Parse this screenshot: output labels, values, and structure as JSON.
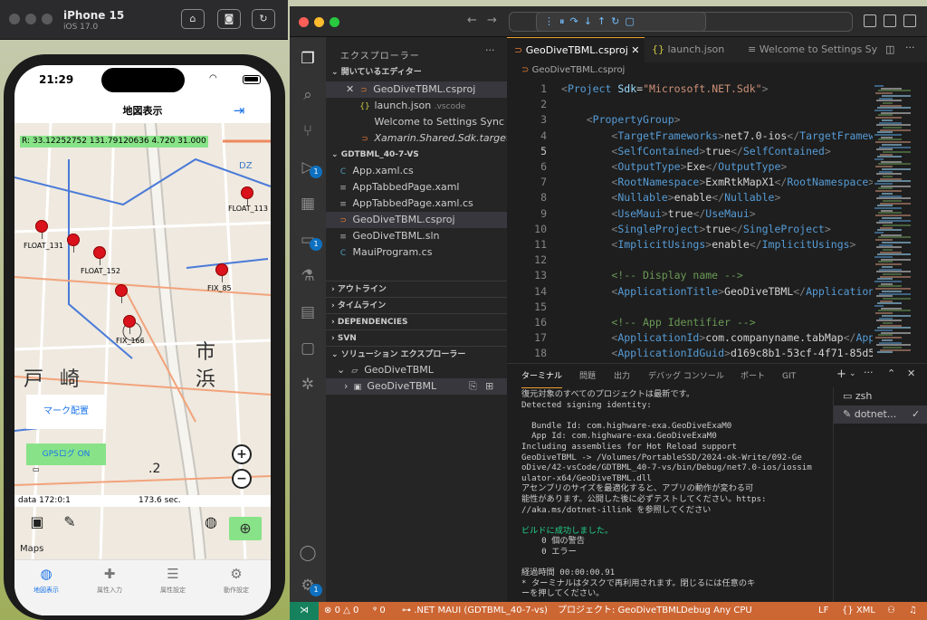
{
  "simulator": {
    "device": "iPhone 15",
    "os": "iOS 17.0",
    "buttons": [
      "home-icon",
      "screenshot-icon",
      "rotate-icon"
    ]
  },
  "phone": {
    "time": "21:29",
    "nav_title": "地図表示",
    "coord_readout": "R: 33.12252752 131.79120636 4.720 31.000",
    "dz_label": "DZ",
    "pins": [
      {
        "label": "FLOAT_113"
      },
      {
        "label": "FLOAT_131"
      },
      {
        "label": "FLOAT_152"
      },
      {
        "label": "FIX_85"
      },
      {
        "label": "FIX_166"
      }
    ],
    "mark_button": "マーク配置",
    "gps_button": "GPSログ ON",
    "scale_label": ".2",
    "data_text": "data 172:0:1",
    "sec_text": "173.6 sec.",
    "maps_label": "Maps",
    "tabs": [
      {
        "label": "地図表示",
        "icon": "globe-icon"
      },
      {
        "label": "属性入力",
        "icon": "pin-icon"
      },
      {
        "label": "属性設定",
        "icon": "list-icon"
      },
      {
        "label": "動作設定",
        "icon": "gear-icon"
      }
    ]
  },
  "vscode": {
    "sidebar_title": "エクスプローラー",
    "open_editors_header": "開いているエディター",
    "open_editors": [
      {
        "name": "GeoDiveTBML.csproj",
        "suffix": ""
      },
      {
        "name": "launch.json",
        "suffix": ".vscode"
      },
      {
        "name": "Welcome to Settings Sync",
        "suffix": ""
      },
      {
        "name": "Xamarin.Shared.Sdk.targets...",
        "suffix": ""
      }
    ],
    "folder_header": "GDTBML_40-7-VS",
    "files": [
      "App.xaml.cs",
      "AppTabbedPage.xaml",
      "AppTabbedPage.xaml.cs",
      "GeoDiveTBML.csproj",
      "GeoDiveTBML.sln",
      "MauiProgram.cs"
    ],
    "sections": [
      "アウトライン",
      "タイムライン",
      "DEPENDENCIES",
      "SVN",
      "ソリューション エクスプローラー"
    ],
    "solution": "GeoDiveTBML",
    "solution_project": "GeoDiveTBML",
    "editor_tabs": [
      "GeoDiveTBML.csproj",
      "launch.json",
      "Welcome to Settings Sync"
    ],
    "breadcrumb": "GeoDiveTBML.csproj",
    "code_lines": [
      {
        "n": "1",
        "t": "<Project Sdk=\"Microsoft.NET.Sdk\">"
      },
      {
        "n": "2",
        "t": ""
      },
      {
        "n": "3",
        "t": "    <PropertyGroup>"
      },
      {
        "n": "4",
        "t": "        <TargetFrameworks>net7.0-ios</TargetFramew"
      },
      {
        "n": "5",
        "t": "        <SelfContained>true</SelfContained>"
      },
      {
        "n": "6",
        "t": "        <OutputType>Exe</OutputType>"
      },
      {
        "n": "7",
        "t": "        <RootNamespace>ExmRtkMapX1</RootNamespace>"
      },
      {
        "n": "8",
        "t": "        <Nullable>enable</Nullable>"
      },
      {
        "n": "9",
        "t": "        <UseMaui>true</UseMaui>"
      },
      {
        "n": "10",
        "t": "        <SingleProject>true</SingleProject>"
      },
      {
        "n": "11",
        "t": "        <ImplicitUsings>enable</ImplicitUsings>"
      },
      {
        "n": "12",
        "t": ""
      },
      {
        "n": "13",
        "t": "        <!-- Display name -->"
      },
      {
        "n": "14",
        "t": "        <ApplicationTitle>GeoDiveTBML</Application"
      },
      {
        "n": "15",
        "t": ""
      },
      {
        "n": "16",
        "t": "        <!-- App Identifier -->"
      },
      {
        "n": "17",
        "t": "        <ApplicationId>com.companyname.tabMap</App"
      },
      {
        "n": "18",
        "t": "        <ApplicationIdGuid>d169c8b1-53cf-4f71-85d5"
      }
    ],
    "panel_tabs": [
      "ターミナル",
      "問題",
      "出力",
      "デバッグ コンソール",
      "ポート",
      "GIT"
    ],
    "terminal": [
      "復元対象のすべてのプロジェクトは最新です。",
      "Detected signing identity:",
      "",
      "  Bundle Id: com.highware-exa.GeoDiveExaM0",
      "  App Id: com.highware-exa.GeoDiveExaM0",
      "Including assemblies for Hot Reload support",
      "GeoDiveTBML -> /Volumes/PortableSSD/2024-ok-Write/092-Ge",
      "oDive/42-vsCode/GDTBML_40-7-vs/bin/Debug/net7.0-ios/iossim",
      "ulator-x64/GeoDiveTBML.dll",
      "アセンブリのサイズを最適化すると、アプリの動作が変わる可",
      "能性があります。公開した後に必ずテストしてください。https:",
      "//aka.ms/dotnet-illink を参照してください",
      "",
      "ビルドに成功しました。",
      "    0 個の警告",
      "    0 エラー",
      "",
      "経過時間 00:00:00.91",
      "* ターミナルはタスクで再利用されます。閉じるには任意のキ",
      "ーを押してください。"
    ],
    "terminals": [
      {
        "name": "zsh",
        "icon": "terminal-icon"
      },
      {
        "name": "dotnet...",
        "icon": "wrench-icon"
      }
    ],
    "status": {
      "errors": "0",
      "warnings": "0",
      "ports": "0",
      "maui": ".NET MAUI (GDTBML_40-7-vs)",
      "project": "プロジェクト: GeoDiveTBML",
      "config": "Debug Any CPU",
      "eol": "LF",
      "lang": "{} XML"
    }
  }
}
